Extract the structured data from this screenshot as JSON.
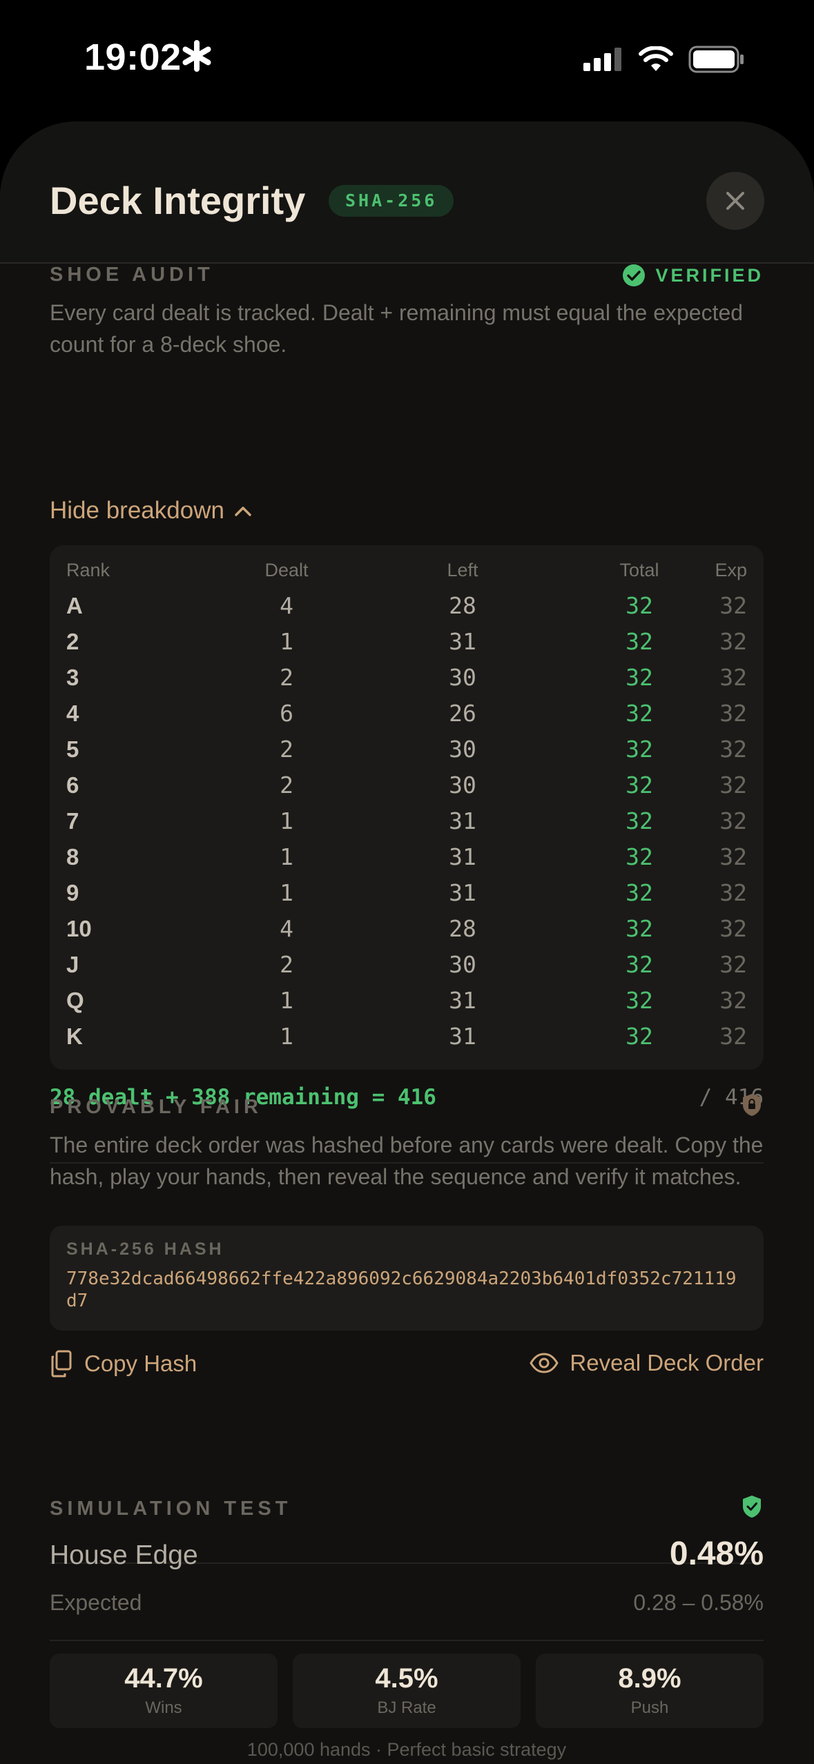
{
  "status_bar": {
    "time": "19:02"
  },
  "header": {
    "title": "Deck Integrity",
    "badge": "SHA-256"
  },
  "shoe_audit": {
    "label": "SHOE AUDIT",
    "status": "VERIFIED",
    "description": "Every card dealt is tracked. Dealt + remaining must equal the expected count for a 8-deck shoe.",
    "toggle_label": "Hide breakdown",
    "columns": [
      "Rank",
      "Dealt",
      "Left",
      "Total",
      "Exp"
    ],
    "rows": [
      [
        "A",
        "4",
        "28",
        "32",
        "32"
      ],
      [
        "2",
        "1",
        "31",
        "32",
        "32"
      ],
      [
        "3",
        "2",
        "30",
        "32",
        "32"
      ],
      [
        "4",
        "6",
        "26",
        "32",
        "32"
      ],
      [
        "5",
        "2",
        "30",
        "32",
        "32"
      ],
      [
        "6",
        "2",
        "30",
        "32",
        "32"
      ],
      [
        "7",
        "1",
        "31",
        "32",
        "32"
      ],
      [
        "8",
        "1",
        "31",
        "32",
        "32"
      ],
      [
        "9",
        "1",
        "31",
        "32",
        "32"
      ],
      [
        "10",
        "4",
        "28",
        "32",
        "32"
      ],
      [
        "J",
        "2",
        "30",
        "32",
        "32"
      ],
      [
        "Q",
        "1",
        "31",
        "32",
        "32"
      ],
      [
        "K",
        "1",
        "31",
        "32",
        "32"
      ]
    ],
    "summary": "28 dealt + 388 remaining = 416",
    "summary_total": "/ 416"
  },
  "provably_fair": {
    "label": "PROVABLY FAIR",
    "description": "The entire deck order was hashed before any cards were dealt. Copy the hash, play your hands, then reveal the sequence and verify it matches.",
    "hash_label": "SHA-256 HASH",
    "hash_value": "778e32dcad66498662ffe422a896092c6629084a2203b6401df0352c721119d7",
    "copy_label": "Copy Hash",
    "reveal_label": "Reveal Deck Order"
  },
  "simulation": {
    "label": "SIMULATION TEST",
    "house_edge_label": "House Edge",
    "house_edge_value": "0.48%",
    "expected_label": "Expected",
    "expected_value": "0.28 – 0.58%",
    "stats": [
      {
        "value": "44.7%",
        "label": "Wins"
      },
      {
        "value": "4.5%",
        "label": "BJ Rate"
      },
      {
        "value": "8.9%",
        "label": "Push"
      }
    ],
    "footnote": "100,000 hands · Perfect basic strategy"
  },
  "colors": {
    "accent_gold": "#cda57a",
    "success_green": "#4cc170",
    "background": "#121110"
  }
}
